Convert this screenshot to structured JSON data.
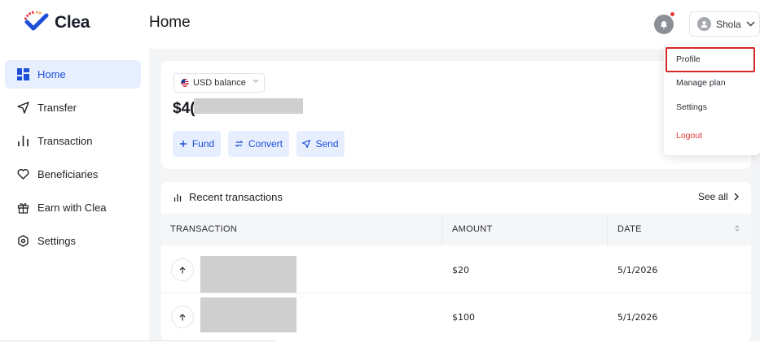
{
  "brand": {
    "name": "Clea",
    "logo_colors": [
      "#e63946",
      "#f4a261",
      "#1d4ed8"
    ]
  },
  "header": {
    "title": "Home",
    "user_name": "Shola",
    "has_notification": true
  },
  "sidebar": {
    "items": [
      {
        "label": "Home",
        "icon": "grid-icon",
        "active": true
      },
      {
        "label": "Transfer",
        "icon": "send-icon",
        "active": false
      },
      {
        "label": "Transaction",
        "icon": "bars-icon",
        "active": false
      },
      {
        "label": "Beneficiaries",
        "icon": "heart-icon",
        "active": false
      },
      {
        "label": "Earn with Clea",
        "icon": "gift-icon",
        "active": false
      },
      {
        "label": "Settings",
        "icon": "gear-icon",
        "active": false
      }
    ]
  },
  "balance": {
    "currency_selector": "USD balance",
    "amount_visible": "$4(",
    "actions": [
      {
        "label": "Fund",
        "icon": "plus-icon"
      },
      {
        "label": "Convert",
        "icon": "convert-icon"
      },
      {
        "label": "Send",
        "icon": "send-icon"
      }
    ]
  },
  "transactions": {
    "title": "Recent transactions",
    "see_all": "See all",
    "columns": [
      "TRANSACTION",
      "AMOUNT",
      "DATE"
    ],
    "rows": [
      {
        "direction": "up-arrow-icon",
        "amount": "$20",
        "date": "5/1/2026"
      },
      {
        "direction": "up-arrow-icon",
        "amount": "$100",
        "date": "5/1/2026"
      }
    ]
  },
  "user_menu": {
    "items": [
      "Profile",
      "Manage plan",
      "Settings",
      "Logout"
    ],
    "highlighted": "Profile"
  },
  "colors": {
    "accent": "#1d4ed8",
    "accent_bg": "#e7efff",
    "danger": "#e5383b",
    "highlight_box": "#d62828"
  }
}
